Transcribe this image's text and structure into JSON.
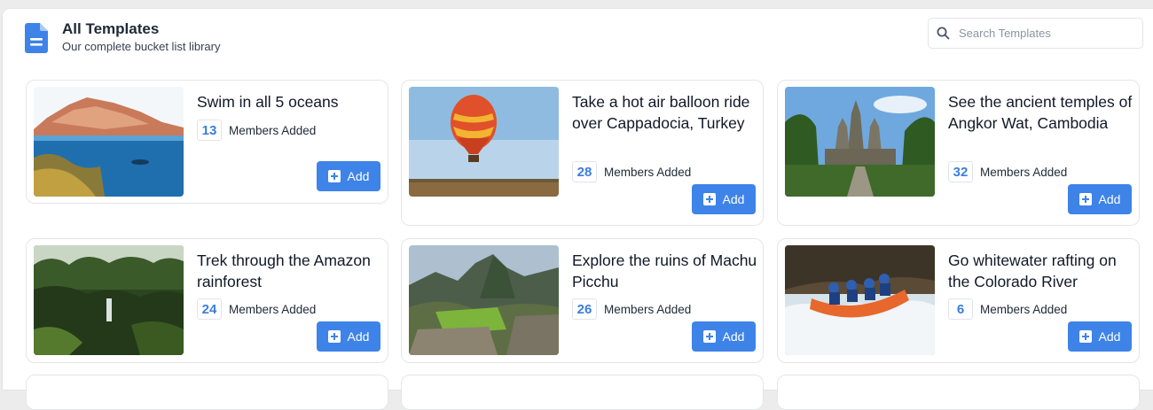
{
  "header": {
    "title": "All Templates",
    "subtitle": "Our complete bucket list library",
    "icon": "document-icon"
  },
  "search": {
    "placeholder": "Search Templates",
    "value": ""
  },
  "colors": {
    "accent": "#3e83e8",
    "count": "#3b7ddd"
  },
  "members_label": "Members Added",
  "add_label": "Add",
  "templates": [
    {
      "title": "Swim in all 5 oceans",
      "members": "13",
      "image": "ocean-photo"
    },
    {
      "title": "Take a hot air balloon ride over Cappadocia, Turkey",
      "members": "28",
      "image": "balloon-photo"
    },
    {
      "title": "See the ancient temples of Angkor Wat, Cambodia",
      "members": "32",
      "image": "temple-photo"
    },
    {
      "title": "Trek through the Amazon rainforest",
      "members": "24",
      "image": "rainforest-photo"
    },
    {
      "title": "Explore the ruins of Machu Picchu",
      "members": "26",
      "image": "machu-picchu-photo"
    },
    {
      "title": "Go whitewater rafting on the Colorado River",
      "members": "6",
      "image": "rafting-photo"
    }
  ]
}
